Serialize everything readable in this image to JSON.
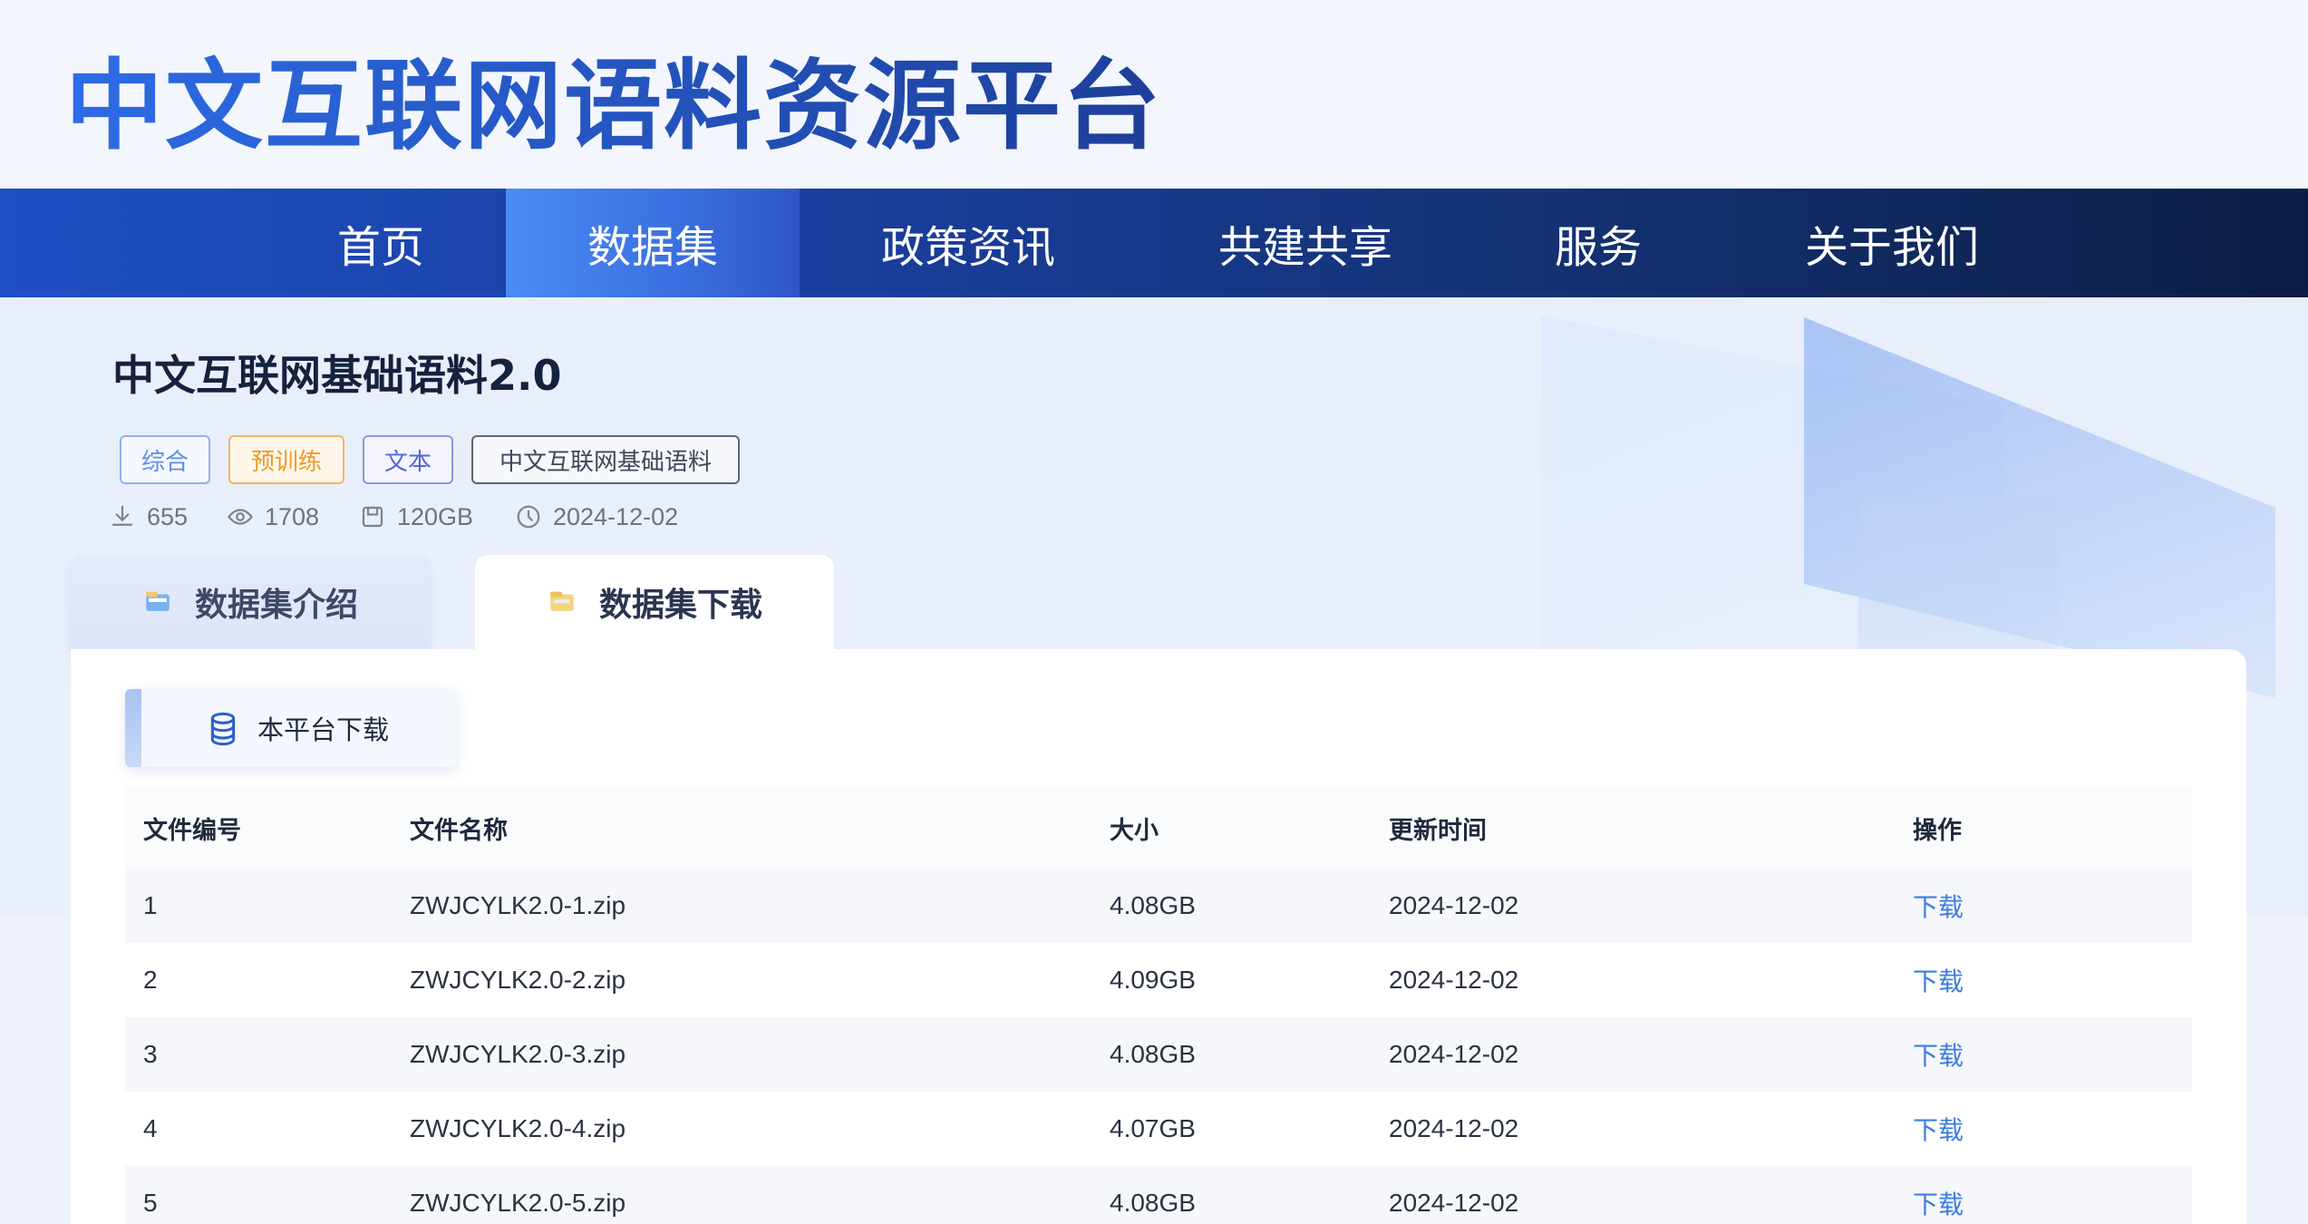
{
  "site": {
    "title": "中文互联网语料资源平台"
  },
  "nav": {
    "items": [
      {
        "label": "首页"
      },
      {
        "label": "数据集"
      },
      {
        "label": "政策资讯"
      },
      {
        "label": "共建共享"
      },
      {
        "label": "服务"
      },
      {
        "label": "关于我们"
      }
    ],
    "active_index": 1
  },
  "dataset": {
    "title": "中文互联网基础语料2.0",
    "tags": [
      {
        "label": "综合",
        "color": "#6b9ae6"
      },
      {
        "label": "预训练",
        "color": "#f0a23b"
      },
      {
        "label": "文本",
        "color": "#5b6fd6"
      },
      {
        "label": "中文互联网基础语料",
        "color": "#4a5266"
      }
    ],
    "stats": {
      "downloads": "655",
      "views": "1708",
      "size": "120GB",
      "date": "2024-12-02"
    }
  },
  "tabs": [
    {
      "label": "数据集介绍",
      "icon": "folder-icon"
    },
    {
      "label": "数据集下载",
      "icon": "download-folder-icon"
    }
  ],
  "active_tab": 1,
  "download": {
    "subtab_label": "本平台下载",
    "subtab_icon": "database-icon",
    "columns": [
      "文件编号",
      "文件名称",
      "大小",
      "更新时间",
      "操作"
    ],
    "rows": [
      {
        "id": "1",
        "name": "ZWJCYLK2.0-1.zip",
        "size": "4.08GB",
        "time": "2024-12-02",
        "action": "下载"
      },
      {
        "id": "2",
        "name": "ZWJCYLK2.0-2.zip",
        "size": "4.09GB",
        "time": "2024-12-02",
        "action": "下载"
      },
      {
        "id": "3",
        "name": "ZWJCYLK2.0-3.zip",
        "size": "4.08GB",
        "time": "2024-12-02",
        "action": "下载"
      },
      {
        "id": "4",
        "name": "ZWJCYLK2.0-4.zip",
        "size": "4.07GB",
        "time": "2024-12-02",
        "action": "下载"
      },
      {
        "id": "5",
        "name": "ZWJCYLK2.0-5.zip",
        "size": "4.08GB",
        "time": "2024-12-02",
        "action": "下载"
      }
    ]
  },
  "colors": {
    "brand": "#2a5bd7",
    "nav_dark": "#0c1d45",
    "link": "#3b7de0"
  }
}
